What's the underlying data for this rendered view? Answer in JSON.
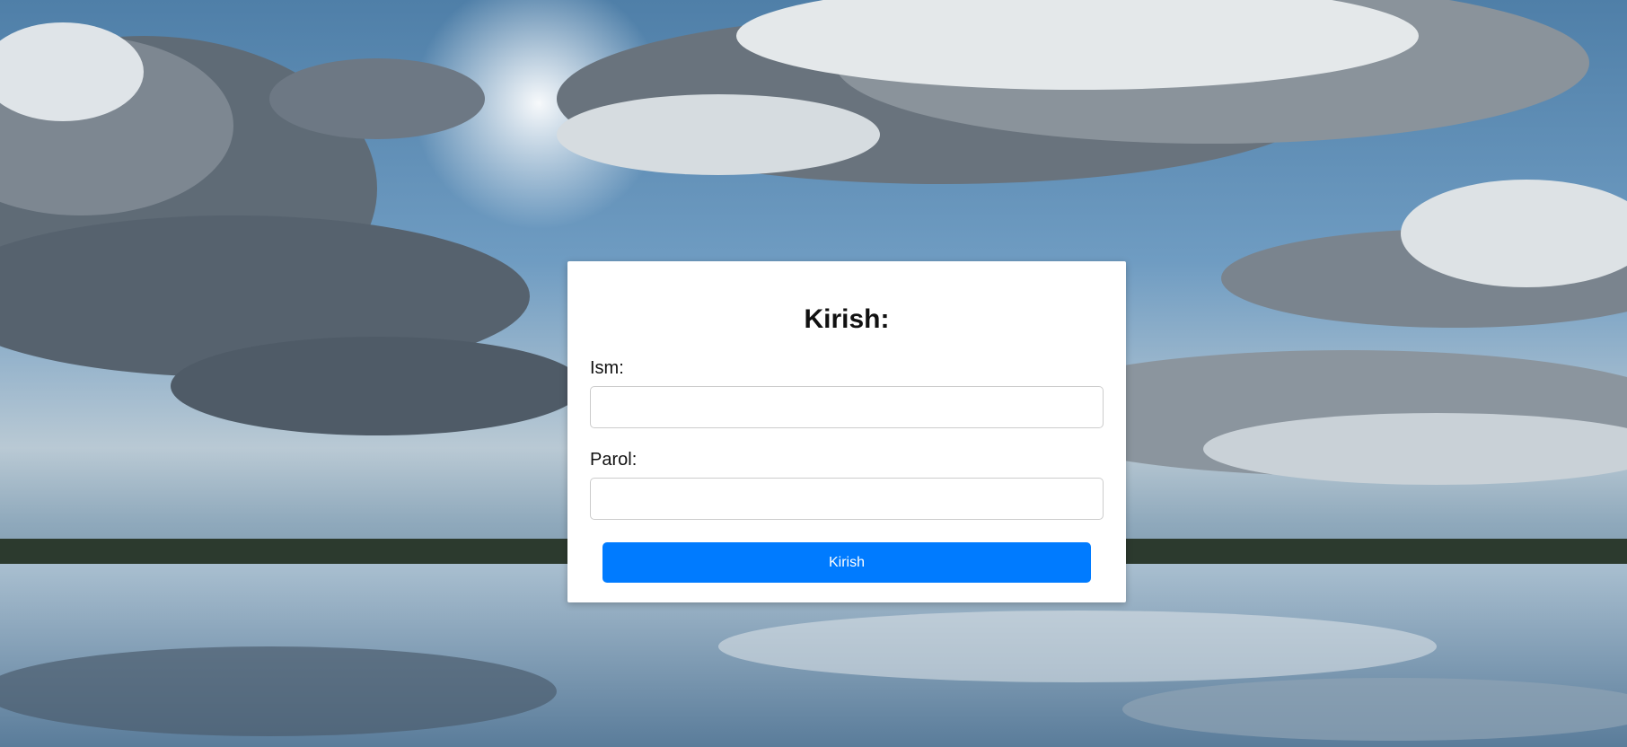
{
  "login": {
    "title": "Kirish:",
    "username_label": "Ism:",
    "username_value": "",
    "password_label": "Parol:",
    "password_value": "",
    "submit_label": "Kirish"
  },
  "colors": {
    "button": "#007bff",
    "card": "#ffffff"
  }
}
